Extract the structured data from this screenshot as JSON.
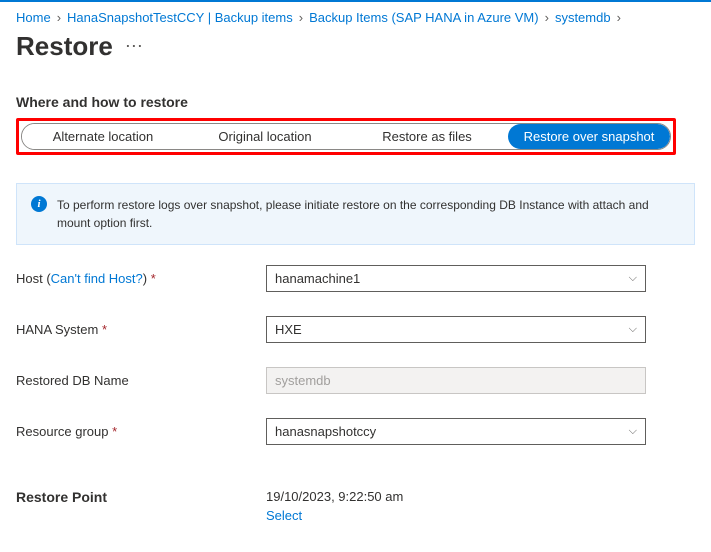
{
  "breadcrumb": {
    "home": "Home",
    "vault": "HanaSnapshotTestCCY | Backup items",
    "items": "Backup Items (SAP HANA in Azure VM)",
    "db": "systemdb"
  },
  "title": "Restore",
  "section_label": "Where and how to restore",
  "tabs": {
    "alt": "Alternate location",
    "orig": "Original location",
    "files": "Restore as files",
    "snapshot": "Restore over snapshot"
  },
  "info": "To perform restore logs over snapshot, please initiate restore on the corresponding DB Instance with attach and mount option first.",
  "form": {
    "host_label_pre": "Host (",
    "host_link": "Can't find Host?",
    "host_label_post": ")",
    "host_value": "hanamachine1",
    "hana_label": "HANA System",
    "hana_value": "HXE",
    "restored_label": "Restored DB Name",
    "restored_value": "systemdb",
    "rg_label": "Resource group",
    "rg_value": "hanasnapshotccy"
  },
  "restore_point": {
    "label": "Restore Point",
    "value": "19/10/2023, 9:22:50 am",
    "select": "Select"
  },
  "required_mark": " *"
}
